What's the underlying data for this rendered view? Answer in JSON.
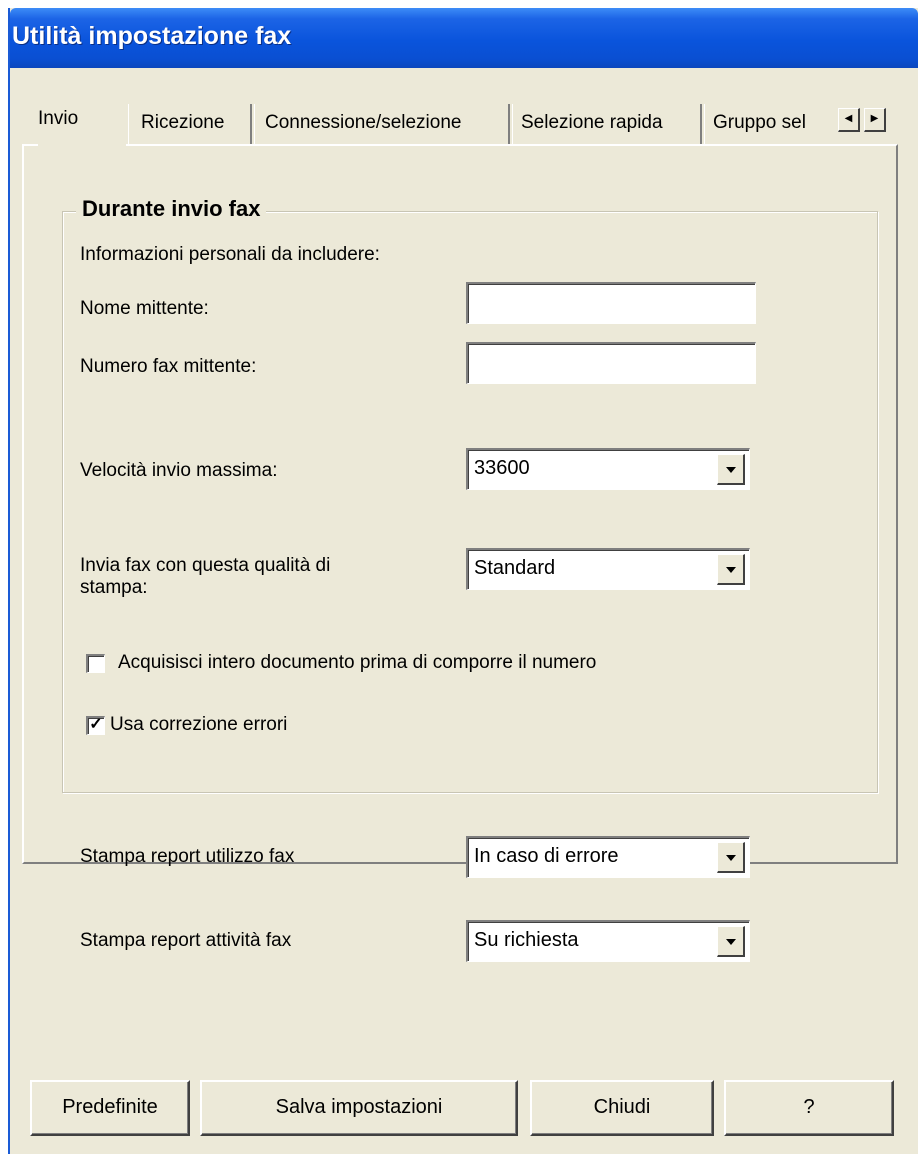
{
  "window": {
    "title": "Utilità impostazione fax"
  },
  "tabs": [
    {
      "label": "Invio",
      "active": true
    },
    {
      "label": "Ricezione",
      "active": false
    },
    {
      "label": "Connessione/selezione",
      "active": false
    },
    {
      "label": "Selezione rapida",
      "active": false
    },
    {
      "label": "Gruppo sel",
      "active": false
    }
  ],
  "tab_scroll": {
    "left_icon": "arrow-left-icon",
    "right_icon": "arrow-right-icon"
  },
  "send_group": {
    "title": "Durante invio fax",
    "personal_info_label": "Informazioni personali da includere:",
    "sender_name_label": "Nome mittente:",
    "sender_name_value": "",
    "sender_fax_label": "Numero fax mittente:",
    "sender_fax_value": "",
    "max_speed_label": "Velocità invio massima:",
    "max_speed_value": "33600",
    "quality_label": "Invia fax con questa qualità di stampa:",
    "quality_value": "Standard",
    "scan_checkbox_label": "Acquisisci intero documento prima di comporre il numero",
    "scan_checkbox_checked": false,
    "ecm_checkbox_label": "Usa correzione errori",
    "ecm_checkbox_checked": true
  },
  "reports": {
    "usage_label": "Stampa report utilizzo fax",
    "usage_value": "In caso di errore",
    "activity_label": "Stampa report attività fax",
    "activity_value": "Su richiesta"
  },
  "buttons": {
    "defaults": "Predefinite",
    "save": "Salva impostazioni",
    "close": "Chiudi",
    "help": "?"
  },
  "colors": {
    "titlebar": "#0a54dc",
    "window_bg": "#ece9d8",
    "title_text": "#ffffff"
  }
}
